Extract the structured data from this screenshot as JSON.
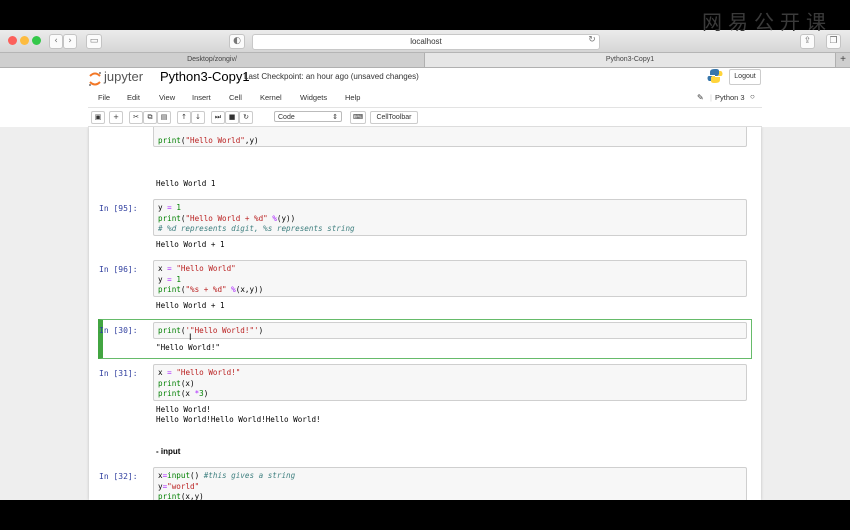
{
  "watermark": "网易公开课",
  "browser": {
    "url": "localhost",
    "tabs": [
      "Desktop/zongiv/",
      "Python3-Copy1"
    ]
  },
  "jupyter": {
    "logo": "jupyter",
    "notebook_title": "Python3-Copy1",
    "checkpoint": "Last Checkpoint: an hour ago (unsaved changes)",
    "logout": "Logout",
    "kernel": "Python 3",
    "menu": [
      "File",
      "Edit",
      "View",
      "Insert",
      "Cell",
      "Kernel",
      "Widgets",
      "Help"
    ],
    "cell_type": "Code",
    "celltoolbar": "CellToolbar"
  },
  "cells": {
    "c0": {
      "code1": "print(\"Hello World\",y)",
      "out": "Hello World 1"
    },
    "c1": {
      "prompt": "In [95]:",
      "out": "Hello World + 1"
    },
    "c2": {
      "prompt": "In [96]:",
      "out": "Hello World + 1"
    },
    "c3": {
      "prompt": "In [30]:",
      "out": "\"Hello World!\""
    },
    "c4": {
      "prompt": "In [31]:",
      "out1": "Hello World!",
      "out2": "Hello World!Hello World!Hello World!"
    },
    "md": {
      "text": "- input"
    },
    "c5": {
      "prompt": "In [32]:"
    }
  }
}
